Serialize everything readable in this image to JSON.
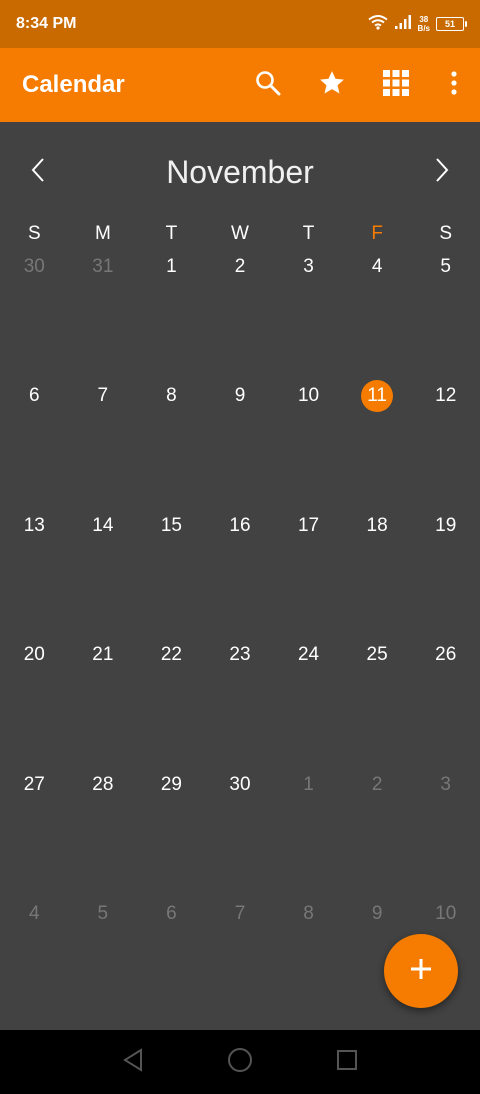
{
  "status_bar": {
    "time": "8:34 PM",
    "net_speed_value": "38",
    "net_speed_unit": "B/s",
    "battery": "51"
  },
  "app_bar": {
    "title": "Calendar",
    "actions": [
      "search-icon",
      "star-icon",
      "grid-icon",
      "more-vert-icon"
    ]
  },
  "month": {
    "title": "November"
  },
  "weekdays": [
    "S",
    "M",
    "T",
    "W",
    "T",
    "F",
    "S"
  ],
  "highlight_weekday_index": 5,
  "weeks": [
    [
      {
        "d": "30",
        "o": true
      },
      {
        "d": "31",
        "o": true
      },
      {
        "d": "1"
      },
      {
        "d": "2"
      },
      {
        "d": "3"
      },
      {
        "d": "4"
      },
      {
        "d": "5"
      }
    ],
    [
      {
        "d": "6"
      },
      {
        "d": "7"
      },
      {
        "d": "8"
      },
      {
        "d": "9"
      },
      {
        "d": "10"
      },
      {
        "d": "11",
        "today": true
      },
      {
        "d": "12"
      }
    ],
    [
      {
        "d": "13"
      },
      {
        "d": "14"
      },
      {
        "d": "15"
      },
      {
        "d": "16"
      },
      {
        "d": "17"
      },
      {
        "d": "18"
      },
      {
        "d": "19"
      }
    ],
    [
      {
        "d": "20"
      },
      {
        "d": "21"
      },
      {
        "d": "22"
      },
      {
        "d": "23"
      },
      {
        "d": "24"
      },
      {
        "d": "25"
      },
      {
        "d": "26"
      }
    ],
    [
      {
        "d": "27"
      },
      {
        "d": "28"
      },
      {
        "d": "29"
      },
      {
        "d": "30"
      },
      {
        "d": "1",
        "o": true
      },
      {
        "d": "2",
        "o": true
      },
      {
        "d": "3",
        "o": true
      }
    ],
    [
      {
        "d": "4",
        "o": true
      },
      {
        "d": "5",
        "o": true
      },
      {
        "d": "6",
        "o": true
      },
      {
        "d": "7",
        "o": true
      },
      {
        "d": "8",
        "o": true
      },
      {
        "d": "9",
        "o": true
      },
      {
        "d": "10",
        "o": true
      }
    ]
  ],
  "colors": {
    "accent": "#f57c00",
    "status_bar": "#c86a00",
    "background": "#424242",
    "other_month_text": "#777777"
  },
  "fab": {
    "icon": "plus-icon"
  },
  "nav_bar": {
    "icons": [
      "back-icon",
      "home-icon",
      "recents-icon"
    ]
  }
}
